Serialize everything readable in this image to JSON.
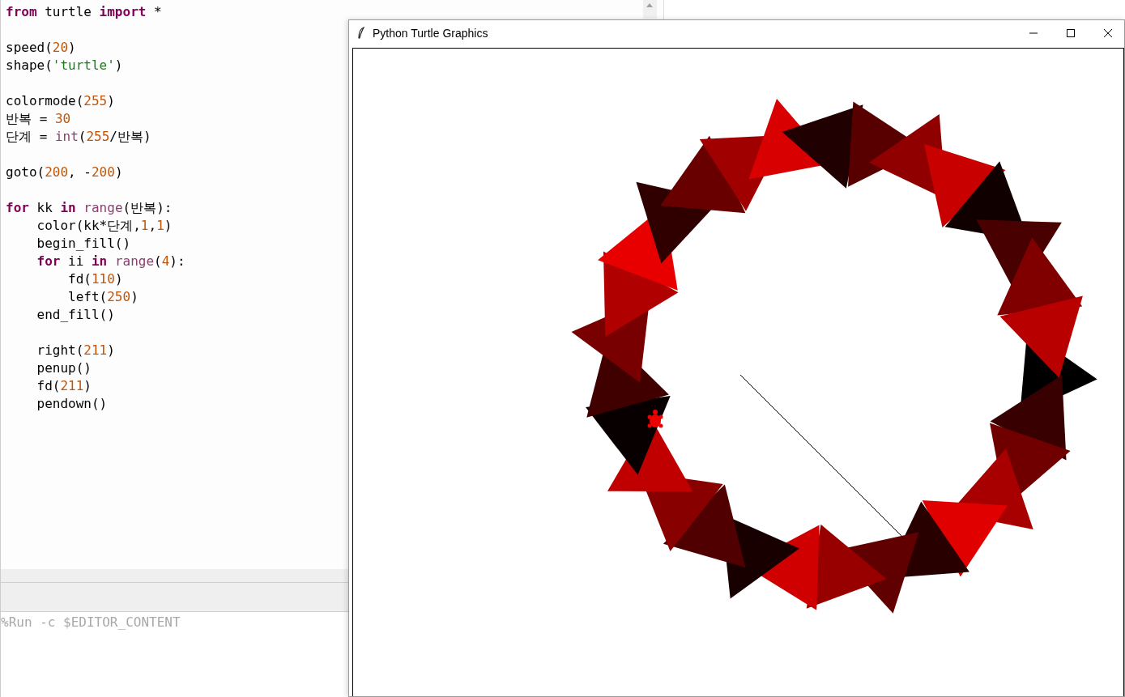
{
  "editor": {
    "lines": [
      {
        "kind": "code",
        "tokens": [
          {
            "text": "from",
            "kind": "keyword"
          },
          {
            "text": " turtle ",
            "kind": "plain"
          },
          {
            "text": "import",
            "kind": "keyword"
          },
          {
            "text": " *",
            "kind": "plain"
          }
        ]
      },
      {
        "kind": "blank"
      },
      {
        "kind": "code",
        "tokens": [
          {
            "text": "speed(",
            "kind": "plain"
          },
          {
            "text": "20",
            "kind": "number"
          },
          {
            "text": ")",
            "kind": "plain"
          }
        ]
      },
      {
        "kind": "code",
        "tokens": [
          {
            "text": "shape(",
            "kind": "plain"
          },
          {
            "text": "'turtle'",
            "kind": "string"
          },
          {
            "text": ")",
            "kind": "plain"
          }
        ]
      },
      {
        "kind": "blank"
      },
      {
        "kind": "code",
        "tokens": [
          {
            "text": "colormode(",
            "kind": "plain"
          },
          {
            "text": "255",
            "kind": "number"
          },
          {
            "text": ")",
            "kind": "plain"
          }
        ]
      },
      {
        "kind": "code",
        "tokens": [
          {
            "text": "반복 = ",
            "kind": "plain"
          },
          {
            "text": "30",
            "kind": "number"
          }
        ]
      },
      {
        "kind": "code",
        "tokens": [
          {
            "text": "단계 = ",
            "kind": "plain"
          },
          {
            "text": "int",
            "kind": "builtin"
          },
          {
            "text": "(",
            "kind": "plain"
          },
          {
            "text": "255",
            "kind": "number"
          },
          {
            "text": "/반복)",
            "kind": "plain"
          }
        ]
      },
      {
        "kind": "blank"
      },
      {
        "kind": "code",
        "tokens": [
          {
            "text": "goto(",
            "kind": "plain"
          },
          {
            "text": "200",
            "kind": "number"
          },
          {
            "text": ", -",
            "kind": "plain"
          },
          {
            "text": "200",
            "kind": "number"
          },
          {
            "text": ")",
            "kind": "plain"
          }
        ]
      },
      {
        "kind": "blank"
      },
      {
        "kind": "code",
        "tokens": [
          {
            "text": "for",
            "kind": "keyword"
          },
          {
            "text": " kk ",
            "kind": "plain"
          },
          {
            "text": "in ",
            "kind": "keyword"
          },
          {
            "text": "range",
            "kind": "builtin"
          },
          {
            "text": "(반복):",
            "kind": "plain"
          }
        ]
      },
      {
        "kind": "code",
        "tokens": [
          {
            "text": "    color(kk*단계,",
            "kind": "plain"
          },
          {
            "text": "1",
            "kind": "number"
          },
          {
            "text": ",",
            "kind": "plain"
          },
          {
            "text": "1",
            "kind": "number"
          },
          {
            "text": ")",
            "kind": "plain"
          }
        ]
      },
      {
        "kind": "code",
        "tokens": [
          {
            "text": "    begin_fill()",
            "kind": "plain"
          }
        ]
      },
      {
        "kind": "code",
        "tokens": [
          {
            "text": "    for",
            "kind": "keyword"
          },
          {
            "text": " ii ",
            "kind": "plain"
          },
          {
            "text": "in ",
            "kind": "keyword"
          },
          {
            "text": "range",
            "kind": "builtin"
          },
          {
            "text": "(",
            "kind": "plain"
          },
          {
            "text": "4",
            "kind": "number"
          },
          {
            "text": "):",
            "kind": "plain"
          }
        ]
      },
      {
        "kind": "code",
        "tokens": [
          {
            "text": "        fd(",
            "kind": "plain"
          },
          {
            "text": "110",
            "kind": "number"
          },
          {
            "text": ")",
            "kind": "plain"
          }
        ]
      },
      {
        "kind": "code",
        "tokens": [
          {
            "text": "        left(",
            "kind": "plain"
          },
          {
            "text": "250",
            "kind": "number"
          },
          {
            "text": ")",
            "kind": "plain"
          }
        ]
      },
      {
        "kind": "code",
        "tokens": [
          {
            "text": "    end_fill()",
            "kind": "plain"
          }
        ]
      },
      {
        "kind": "blank"
      },
      {
        "kind": "code",
        "tokens": [
          {
            "text": "    right(",
            "kind": "plain"
          },
          {
            "text": "211",
            "kind": "number"
          },
          {
            "text": ")",
            "kind": "plain"
          }
        ]
      },
      {
        "kind": "code",
        "tokens": [
          {
            "text": "    penup()",
            "kind": "plain"
          }
        ]
      },
      {
        "kind": "code",
        "tokens": [
          {
            "text": "    fd(",
            "kind": "plain"
          },
          {
            "text": "211",
            "kind": "number"
          },
          {
            "text": ")",
            "kind": "plain"
          }
        ]
      },
      {
        "kind": "code",
        "tokens": [
          {
            "text": "    pendown()",
            "kind": "plain"
          }
        ]
      }
    ]
  },
  "shell": {
    "command": "%Run -c $EDITOR_CONTENT"
  },
  "turtle_window": {
    "title": "Python Turtle Graphics"
  }
}
